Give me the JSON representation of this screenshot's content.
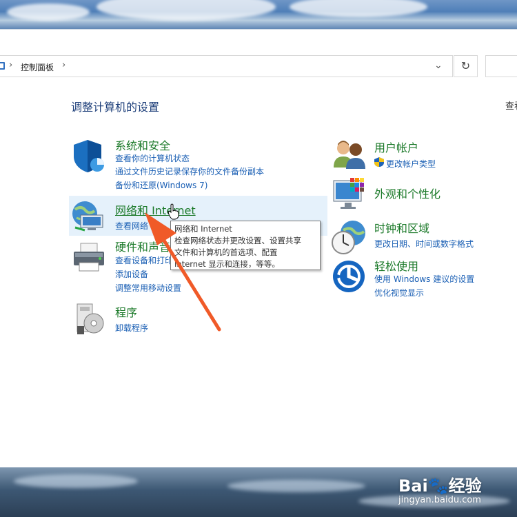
{
  "address_bar": {
    "breadcrumb": "控制面板"
  },
  "main": {
    "heading": "调整计算机的设置",
    "view_by": "查看"
  },
  "categories": {
    "system": {
      "title": "系统和安全",
      "links": [
        "查看你的计算机状态",
        "通过文件历史记录保存你的文件备份副本",
        "备份和还原(Windows 7)"
      ]
    },
    "network": {
      "title": "网络和 Internet",
      "links": [
        "查看网络"
      ]
    },
    "hardware": {
      "title": "硬件和声音",
      "links": [
        "查看设备和打印机",
        "添加设备",
        "调整常用移动设置"
      ]
    },
    "programs": {
      "title": "程序",
      "links": [
        "卸载程序"
      ]
    },
    "user": {
      "title": "用户帐户",
      "links": [
        "更改帐户类型"
      ]
    },
    "appearance": {
      "title": "外观和个性化",
      "links": []
    },
    "clock": {
      "title": "时钟和区域",
      "links": [
        "更改日期、时间或数字格式"
      ]
    },
    "ease": {
      "title": "轻松使用",
      "links": [
        "使用 Windows 建议的设置",
        "优化视觉显示"
      ]
    }
  },
  "tooltip": {
    "title": "网络和 Internet",
    "lines": [
      "检查网络状态并更改设置、设置共享",
      "文件和计算机的首选项、配置",
      "Internet 显示和连接，等等。"
    ]
  },
  "watermark": {
    "brand": "Bai",
    "brand_cn": "经验",
    "url": "jingyan.baidu.com"
  },
  "colors": {
    "category_title": "#1c7a2a",
    "link": "#1a5fb4",
    "heading": "#1e3f7a",
    "arrow": "#f05a28",
    "highlight": "#e5f1fb"
  }
}
